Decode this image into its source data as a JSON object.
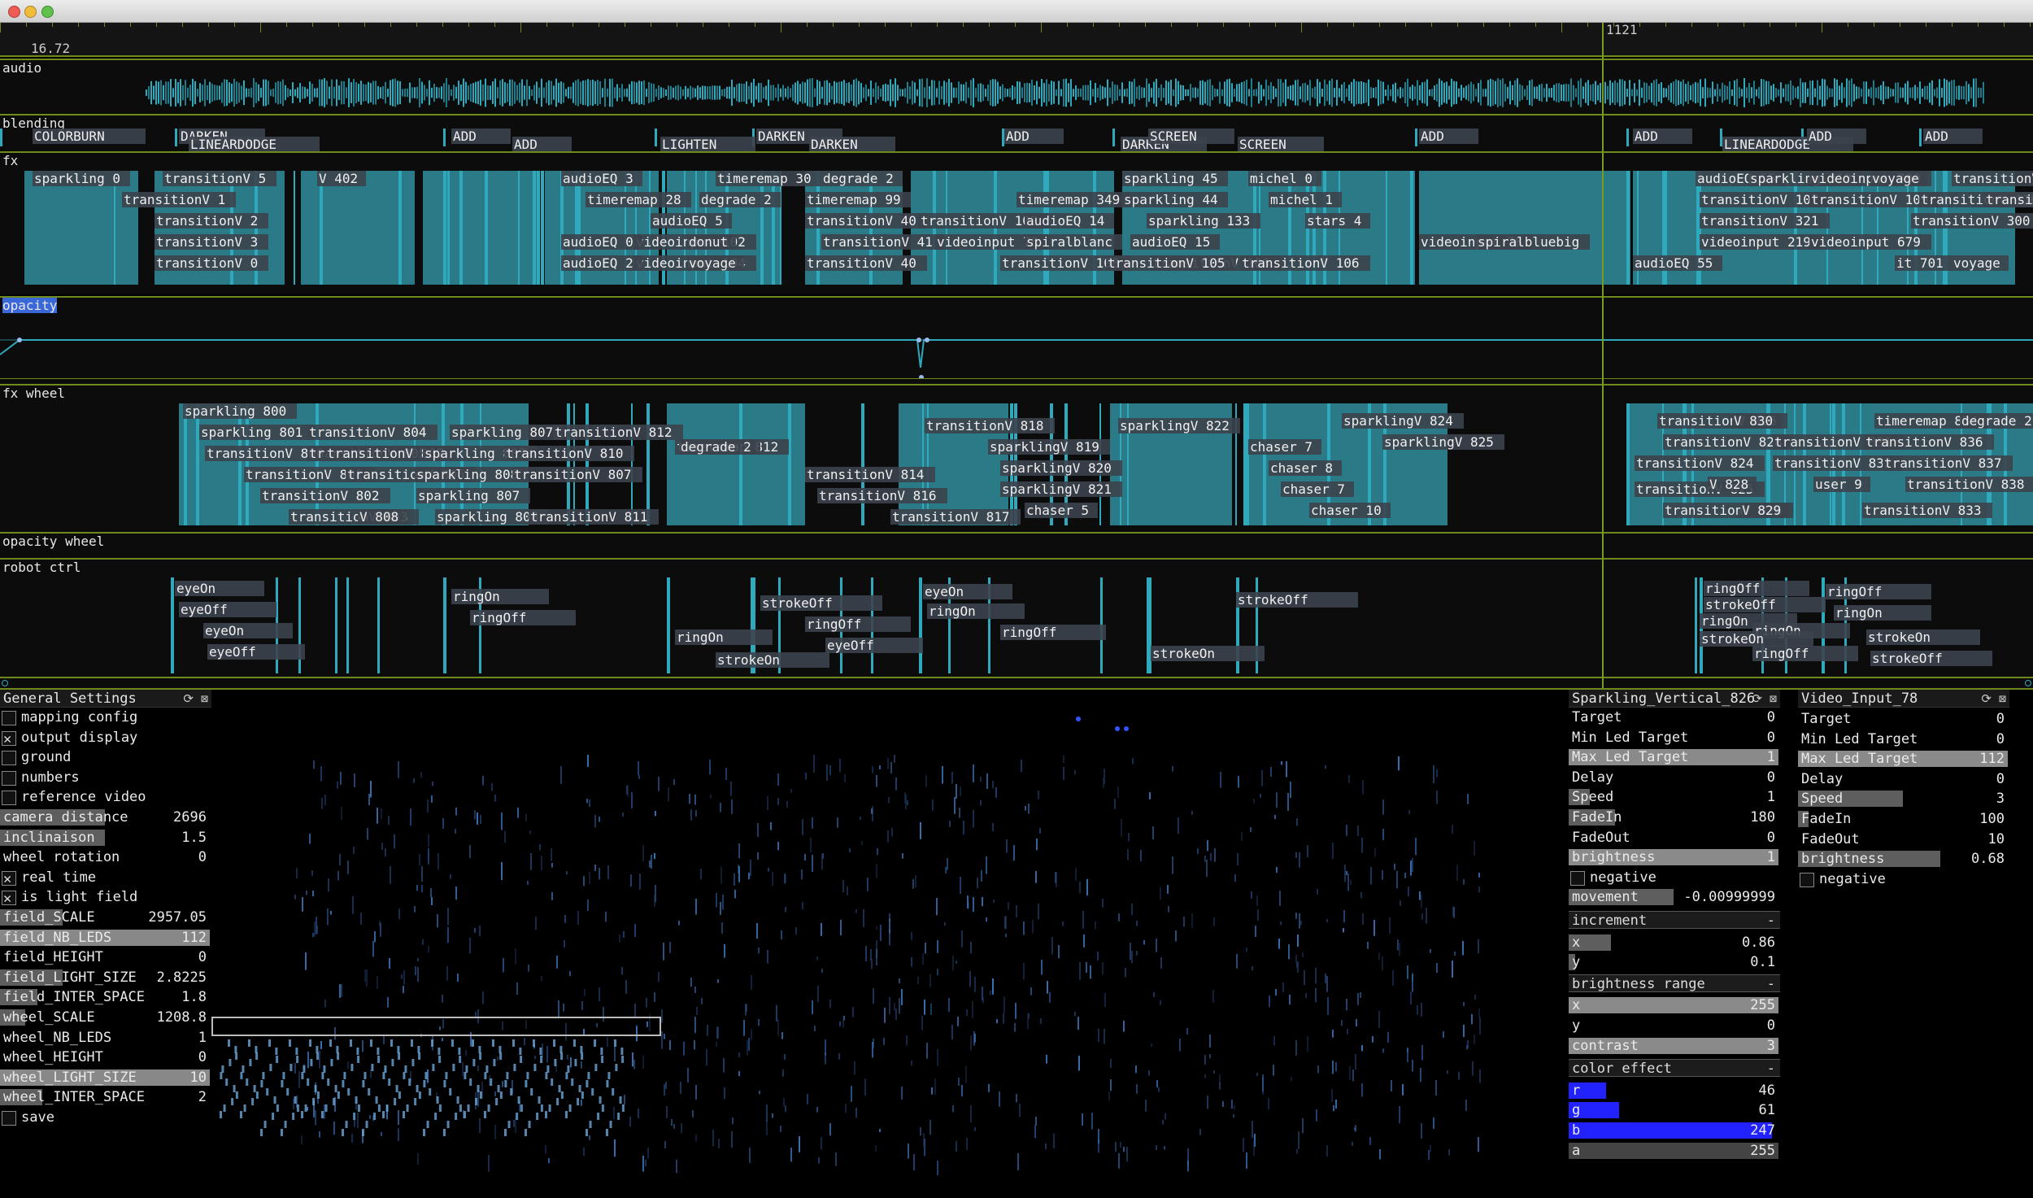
{
  "window": {
    "controls": [
      "close",
      "minimize",
      "zoom"
    ]
  },
  "ruler": {
    "left_value": "16.72",
    "right_value": "1121"
  },
  "tracks": [
    {
      "name": "audio"
    },
    {
      "name": "blending"
    },
    {
      "name": "fx"
    },
    {
      "name": "opacity"
    },
    {
      "name": "fx wheel"
    },
    {
      "name": "opacity wheel"
    },
    {
      "name": "robot ctrl"
    }
  ],
  "blending_labels": [
    "COLORBURN",
    "DARKEN",
    "LINEARDODGE",
    "ADD",
    "ADD",
    "LIGHTEN",
    "DARKEN",
    "DARKEN",
    "ADD",
    "DARKEN",
    "SCREEN",
    "SCREEN",
    "ADD",
    "ADD",
    "LINEARDODGE",
    "ADD",
    "ADD"
  ],
  "fx_labels": [
    "sparkling_0",
    "transitionV_5",
    "transitionV_1",
    "transitionV_2",
    "transitionV_3",
    "transitionV_0",
    "V_402",
    "timeremap_30",
    "degrade_2",
    "timeremap_28",
    "degrade_2",
    "timeremap_99",
    "timeremap_349",
    "sparkling_45",
    "sparkling_44",
    "michel_0",
    "michel_1",
    "stars_4",
    "transitionV_40",
    "transitionV_41",
    "transitionV_40",
    "transitionV_102",
    "audioEQ_14",
    "audioEQ_15",
    "sparkling_133",
    "transitionV_106",
    "transitionV_108",
    "transitionV_105",
    "transitionV_106",
    "videoinput_102",
    "donut",
    "videoinput_104",
    "voyage",
    "videoinput_76",
    "spiralblanc",
    "videoinput_78",
    "spiralbluebig",
    "audioEQ_5",
    "audioEQ_0",
    "audioEQ_2",
    "audioEQ_3",
    "audioEQ_55",
    "sparkling_312",
    "transitionV_107",
    "transitionV_321",
    "videoinput_219",
    "audioEQ_55",
    "videoinput_700",
    "voyage",
    "videoinput_679",
    "transitionV_300",
    "transitionV_109",
    "transitionV_110",
    "transitionV_723",
    "transitionV_722",
    "it_701",
    "voyage"
  ],
  "fxwheel_labels": [
    "sparkling_800",
    "sparkling_801",
    "transitionV_800",
    "transitionV_801",
    "transitionV_802",
    "transitionV_803",
    "transitionV_804",
    "transitionV_805",
    "transitionV_806",
    "transitionV_807",
    "V_808",
    "sparkling_807",
    "sparkling_807",
    "sparkling_808",
    "sparkling_807",
    "sparkling_808",
    "transitionV_812",
    "transitionV_810",
    "transitionV_807",
    "transitionV_811",
    "timeremap_812",
    "degrade_2",
    "transitionV_814",
    "transitionV_816",
    "transitionV_817",
    "transitionV_818",
    "sparklingV_819",
    "sparklingV_820",
    "sparklingV_821",
    "chaser_5",
    "sparklingV_822",
    "chaser_7",
    "chaser_8",
    "chaser_7",
    "chaser_10",
    "sparklingV_824",
    "sparklingV_825",
    "transitionV_826",
    "V_830",
    "transitionV_828",
    "transitionV_831",
    "transitionV_824",
    "transitionV_825",
    "transitionV_826",
    "transitionV_832",
    "V_828",
    "user_9",
    "V_829",
    "timeremap_834",
    "degrade_2",
    "transitionV_836",
    "transitionV_837",
    "transitionV_838",
    "transitionV_833"
  ],
  "robot_labels": [
    "eyeOn",
    "eyeOff",
    "eyeOn",
    "eyeOff",
    "ringOn",
    "ringOff",
    "strokeOff",
    "ringOn",
    "ringOff",
    "strokeOn",
    "eyeOn",
    "eyeOff",
    "ringOn",
    "ringOff",
    "strokeOn",
    "strokeOff",
    "ringOff",
    "strokeOff",
    "ringOn",
    "ringOn",
    "strokeOn",
    "ringOff",
    "ringOn",
    "ringOff",
    "strokeOn",
    "strokeOff"
  ],
  "general_settings": {
    "title": "General Settings",
    "rows": [
      {
        "type": "check",
        "label": "mapping config",
        "checked": false
      },
      {
        "type": "check",
        "label": "output display",
        "checked": true
      },
      {
        "type": "check",
        "label": "ground",
        "checked": false
      },
      {
        "type": "check",
        "label": "numbers",
        "checked": false
      },
      {
        "type": "check",
        "label": "reference video",
        "checked": false
      },
      {
        "type": "slider",
        "label": "camera distance",
        "value": "2696",
        "fill": 0.5
      },
      {
        "type": "slider",
        "label": "inclinaison",
        "value": "1.5",
        "fill": 0.5
      },
      {
        "type": "slider",
        "label": "wheel rotation",
        "value": "0",
        "fill": 0
      },
      {
        "type": "check",
        "label": "real time",
        "checked": true
      },
      {
        "type": "check",
        "label": "is light field",
        "checked": true
      },
      {
        "type": "slider",
        "label": "field_SCALE",
        "value": "2957.05",
        "fill": 0.3
      },
      {
        "type": "slider",
        "label": "field_NB_LEDS",
        "value": "112",
        "fill": 1
      },
      {
        "type": "slider",
        "label": "field_HEIGHT",
        "value": "0",
        "fill": 0
      },
      {
        "type": "slider",
        "label": "field_LIGHT_SIZE",
        "value": "2.8225",
        "fill": 0.3
      },
      {
        "type": "slider",
        "label": "field_INTER_SPACE",
        "value": "1.8",
        "fill": 0.18
      },
      {
        "type": "slider",
        "label": "wheel_SCALE",
        "value": "1208.8",
        "fill": 0.12
      },
      {
        "type": "slider",
        "label": "wheel_NB_LEDS",
        "value": "1",
        "fill": 0
      },
      {
        "type": "slider",
        "label": "wheel_HEIGHT",
        "value": "0",
        "fill": 0
      },
      {
        "type": "slider",
        "label": "wheel_LIGHT_SIZE",
        "value": "10",
        "fill": 1
      },
      {
        "type": "slider",
        "label": "wheel_INTER_SPACE",
        "value": "2",
        "fill": 0.2
      },
      {
        "type": "check",
        "label": "save",
        "checked": false
      }
    ]
  },
  "sparkling_panel": {
    "title": "Sparkling_Vertical_826",
    "rows": [
      {
        "label": "Target",
        "value": "0",
        "fill": 0
      },
      {
        "label": "Min Led Target",
        "value": "0",
        "fill": 0
      },
      {
        "label": "Max Led Target",
        "value": "1",
        "fill": 1
      },
      {
        "label": "Delay",
        "value": "0",
        "fill": 0
      },
      {
        "label": "Speed",
        "value": "1",
        "fill": 0.1
      },
      {
        "label": "FadeIn",
        "value": "180",
        "fill": 0.22
      },
      {
        "label": "FadeOut",
        "value": "0",
        "fill": 0
      },
      {
        "label": "brightness",
        "value": "1",
        "fill": 1
      }
    ],
    "negative_label": "negative",
    "movement": {
      "label": "movement",
      "value": "-0.00999999",
      "fill": 0.5
    },
    "increment": {
      "title": "increment",
      "x": {
        "label": "x",
        "value": "0.86",
        "fill": 0.2
      },
      "y": {
        "label": "y",
        "value": "0.1",
        "fill": 0.03
      }
    },
    "brightness_range": {
      "title": "brightness range",
      "x": {
        "label": "x",
        "value": "255",
        "fill": 1
      },
      "y": {
        "label": "y",
        "value": "0",
        "fill": 0
      }
    },
    "contrast": {
      "label": "contrast",
      "value": "3",
      "fill": 1
    },
    "color_effect": {
      "title": "color effect",
      "r": {
        "label": "r",
        "value": "46",
        "fill": 0.18
      },
      "g": {
        "label": "g",
        "value": "61",
        "fill": 0.24
      },
      "b": {
        "label": "b",
        "value": "247",
        "fill": 0.97
      },
      "a": {
        "label": "a",
        "value": "255",
        "fill": 1
      }
    },
    "collapse_symbol": "-"
  },
  "video_panel": {
    "title": "Video_Input_78",
    "rows": [
      {
        "label": "Target",
        "value": "0",
        "fill": 0
      },
      {
        "label": "Min Led Target",
        "value": "0",
        "fill": 0
      },
      {
        "label": "Max Led Target",
        "value": "112",
        "fill": 1
      },
      {
        "label": "Delay",
        "value": "0",
        "fill": 0
      },
      {
        "label": "Speed",
        "value": "3",
        "fill": 0.5
      },
      {
        "label": "FadeIn",
        "value": "100",
        "fill": 0.05
      },
      {
        "label": "FadeOut",
        "value": "10",
        "fill": 0
      },
      {
        "label": "brightness",
        "value": "0.68",
        "fill": 0.68
      }
    ],
    "negative_label": "negative"
  },
  "colors": {
    "accent": "#2fa9bc",
    "block": "#2a7b87",
    "grid": "#6e8a1c",
    "color_r": "#2222ff"
  },
  "icons": [
    "refresh-icon",
    "close-box-icon"
  ]
}
